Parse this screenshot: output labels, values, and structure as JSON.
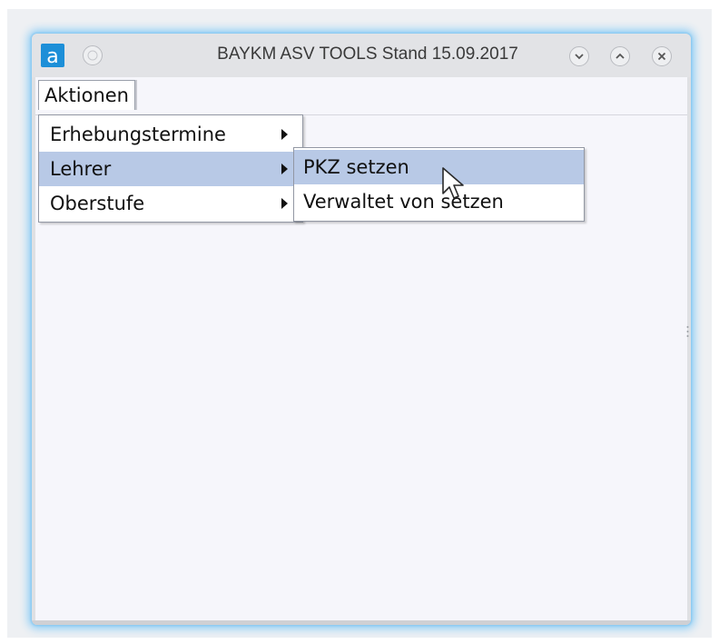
{
  "window": {
    "title": "BAYKM ASV TOOLS Stand 15.09.2017",
    "app_icon_glyph": "a",
    "accent": "#1d8fd8"
  },
  "menubar": {
    "items": [
      {
        "label": "Aktionen"
      }
    ]
  },
  "menu": {
    "items": [
      {
        "label": "Erhebungstermine"
      },
      {
        "label": "Lehrer"
      },
      {
        "label": "Oberstufe"
      }
    ]
  },
  "submenu": {
    "items": [
      {
        "label": "PKZ setzen"
      },
      {
        "label": "Verwaltet von setzen"
      }
    ]
  },
  "colors": {
    "highlight": "#b8c9e6",
    "glow": "#8ccdf5"
  }
}
